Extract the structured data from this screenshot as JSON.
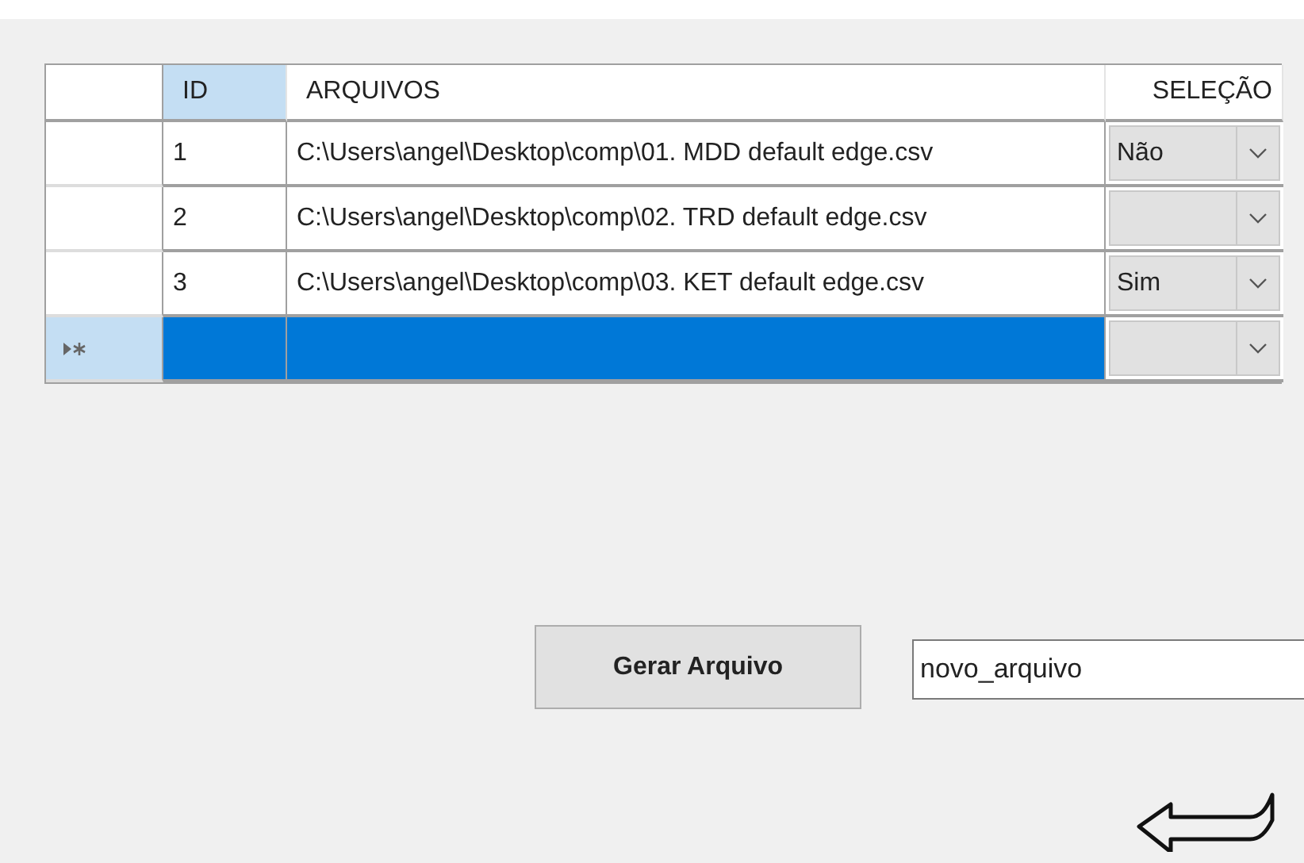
{
  "grid": {
    "columns": [
      {
        "label": "ID",
        "highlighted": true
      },
      {
        "label": "ARQUIVOS",
        "highlighted": false
      },
      {
        "label": "SELEÇÃO",
        "highlighted": false
      }
    ],
    "rows": [
      {
        "kind": "data",
        "id": "1",
        "file": "C:\\Users\\angel\\Desktop\\comp\\01. MDD default edge.csv",
        "selection": "Não",
        "selected": false
      },
      {
        "kind": "data",
        "id": "2",
        "file": "C:\\Users\\angel\\Desktop\\comp\\02. TRD default edge.csv",
        "selected": false
      },
      {
        "kind": "data",
        "id": "3",
        "file": "C:\\Users\\angel\\Desktop\\comp\\03. KET default edge.csv",
        "selection": "Sim",
        "selected": false
      },
      {
        "kind": "new",
        "selected": true
      }
    ]
  },
  "generate_button": {
    "label": "Gerar Arquivo"
  },
  "filename_field": {
    "value": "novo_arquivo"
  }
}
